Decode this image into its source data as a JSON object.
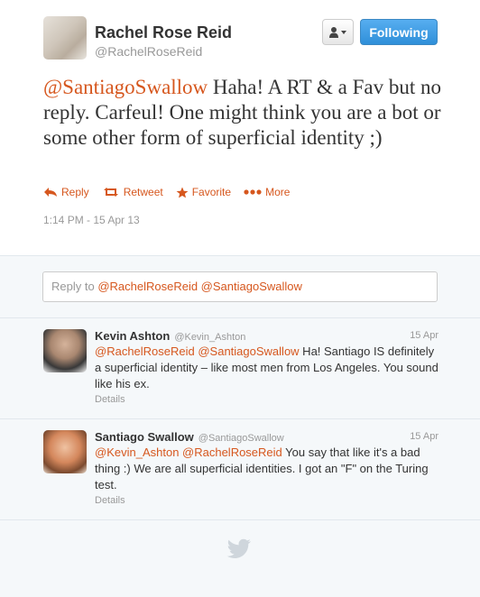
{
  "tweet": {
    "author_name": "Rachel Rose Reid",
    "author_handle": "@RachelRoseReid",
    "follow_label": "Following",
    "text_mention": "@SantiagoSwallow",
    "text_body": " Haha! A RT & a Fav but no reply. Carfeul! One might think you are a bot or some other form of superficial identity ;)",
    "actions": {
      "reply": "Reply",
      "retweet": "Retweet",
      "favorite": "Favorite",
      "more": "More"
    },
    "timestamp": "1:14 PM - 15 Apr 13"
  },
  "reply_box": {
    "prefix": "Reply to ",
    "mentions": "@RachelRoseReid @SantiagoSwallow"
  },
  "replies": [
    {
      "name": "Kevin Ashton",
      "handle": "@Kevin_Ashton",
      "time": "15 Apr",
      "mentions": "@RachelRoseReid @SantiagoSwallow",
      "body": " Ha! Santiago IS definitely a superficial identity – like most men from Los Angeles. You sound like his ex.",
      "details": "Details"
    },
    {
      "name": "Santiago Swallow",
      "handle": "@SantiagoSwallow",
      "time": "15 Apr",
      "mentions": "@Kevin_Ashton @RachelRoseReid",
      "body": " You say that like it's a bad thing :) We are all superficial identities. I got an \"F\" on the Turing test.",
      "details": "Details"
    }
  ],
  "colors": {
    "accent": "#d6571e",
    "follow_button": "#3b94de",
    "muted": "#999999"
  },
  "icons": [
    "user-menu-icon",
    "reply-icon",
    "retweet-icon",
    "favorite-icon",
    "more-icon",
    "twitter-bird-icon"
  ]
}
